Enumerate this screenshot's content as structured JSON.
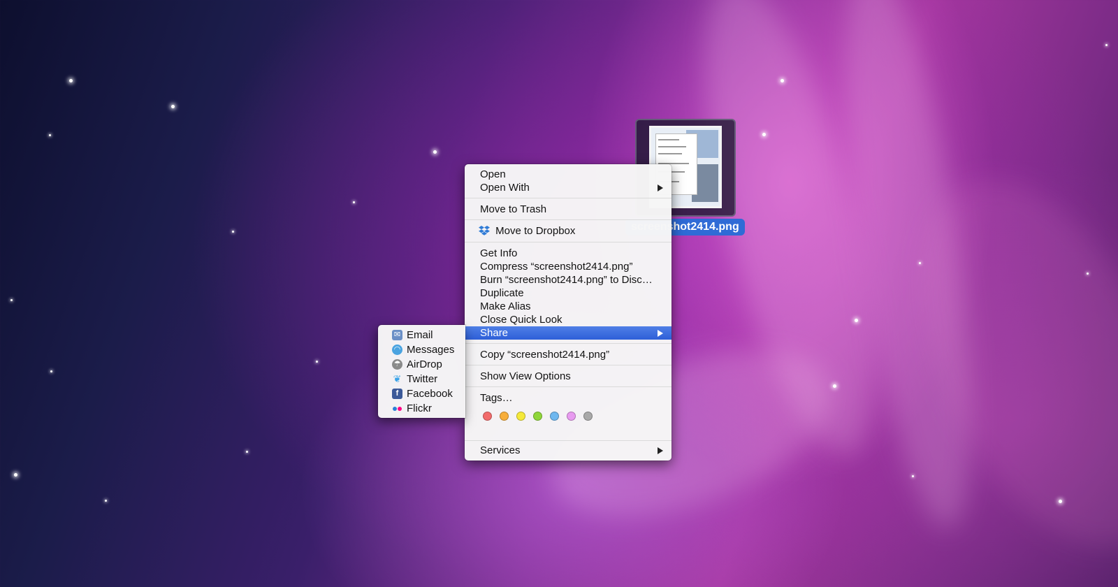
{
  "desktop": {
    "file_name": "screenshot2414.png"
  },
  "context_menu": {
    "open": "Open",
    "open_with": "Open With",
    "move_to_trash": "Move to Trash",
    "move_to_dropbox": "Move to Dropbox",
    "get_info": "Get Info",
    "compress": "Compress “screenshot2414.png”",
    "burn": "Burn “screenshot2414.png” to Disc…",
    "duplicate": "Duplicate",
    "make_alias": "Make Alias",
    "close_quick_look": "Close Quick Look",
    "share": "Share",
    "copy": "Copy “screenshot2414.png”",
    "show_view_options": "Show View Options",
    "tags": "Tags…",
    "services": "Services",
    "highlighted_item": "Share",
    "tag_colors": [
      "#f26b6b",
      "#f7ae3b",
      "#f5e93a",
      "#8fd63a",
      "#6fb8f0",
      "#e89bf0",
      "#a9a9a9"
    ]
  },
  "share_submenu": {
    "items": [
      {
        "label": "Email",
        "icon": "email-icon",
        "color": "#6b8fc6"
      },
      {
        "label": "Messages",
        "icon": "messages-icon",
        "color": "#4aa3e0"
      },
      {
        "label": "AirDrop",
        "icon": "airdrop-icon",
        "color": "#8a8a8a"
      },
      {
        "label": "Twitter",
        "icon": "twitter-icon",
        "color": "#3aa3e8"
      },
      {
        "label": "Facebook",
        "icon": "facebook-icon",
        "color": "#3b5998"
      },
      {
        "label": "Flickr",
        "icon": "flickr-icon",
        "color": "#ff0084"
      }
    ]
  }
}
